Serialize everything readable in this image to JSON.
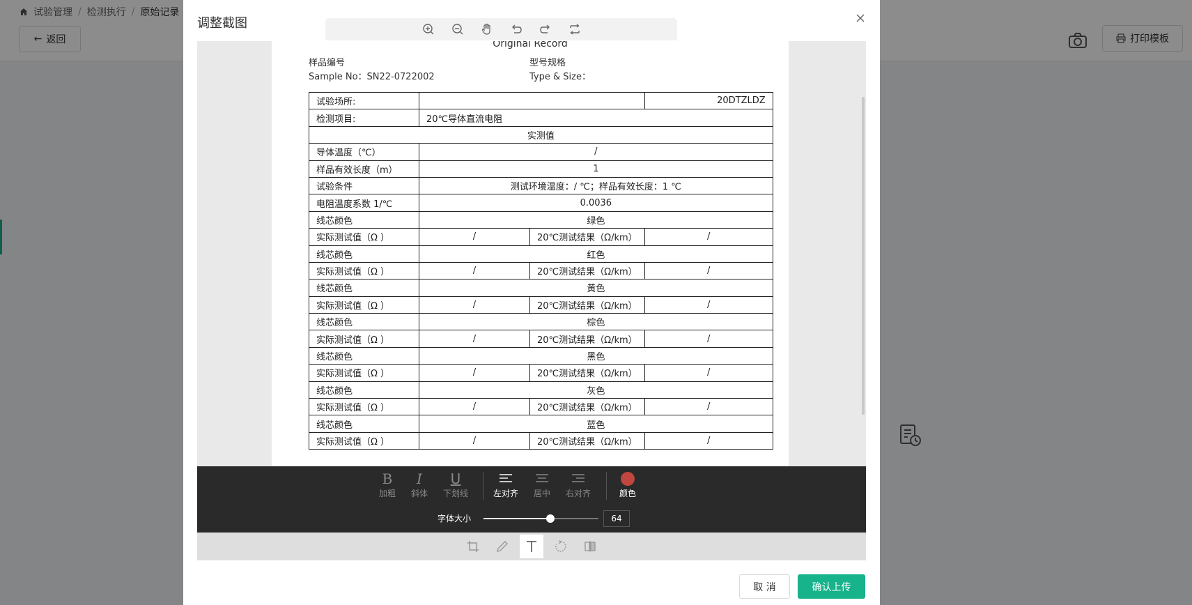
{
  "breadcrumb": [
    "试验管理",
    "检测执行",
    "原始记录"
  ],
  "page": {
    "back_label": "返回",
    "print_label": "打印模板"
  },
  "modal": {
    "title": "调整截图",
    "cancel_label": "取 消",
    "confirm_label": "确认上传"
  },
  "document": {
    "header": "Original Record",
    "sample_no_cn": "样品编号",
    "sample_no_en": "Sample No：SN22-0722002",
    "type_size_cn": "型号规格",
    "type_size_en": "Type & Size：",
    "rows": {
      "site_label": "试验场所:",
      "site_code": "20DTZLDZ",
      "item_label": "检测项目:",
      "item_value": "20℃导体直流电阻",
      "measured_header": "实测值",
      "temp_label": "导体温度（℃）",
      "temp_value": "/",
      "length_label": "样品有效长度（m）",
      "length_value": "1",
      "cond_label": "试验条件",
      "cond_value": "测试环境温度：/ ℃；样品有效长度：1 ℃",
      "coef_label": "电阻温度系数 1/℃",
      "coef_value": "0.0036"
    },
    "core_color_label": "线芯颜色",
    "actual_label": "实际测试值（Ω ）",
    "result_label": "20℃测试结果（Ω/km）",
    "slash": "/",
    "colors": [
      "绿色",
      "红色",
      "黄色",
      "棕色",
      "黑色",
      "灰色",
      "蓝色"
    ]
  },
  "text_panel": {
    "bold": "加粗",
    "italic": "斜体",
    "underline": "下划线",
    "align_left": "左对齐",
    "align_center": "居中",
    "align_right": "右对齐",
    "color": "颜色",
    "color_value": "#c0463f",
    "font_size_label": "字体大小",
    "font_size_value": "64",
    "font_size_level": 0.58
  }
}
